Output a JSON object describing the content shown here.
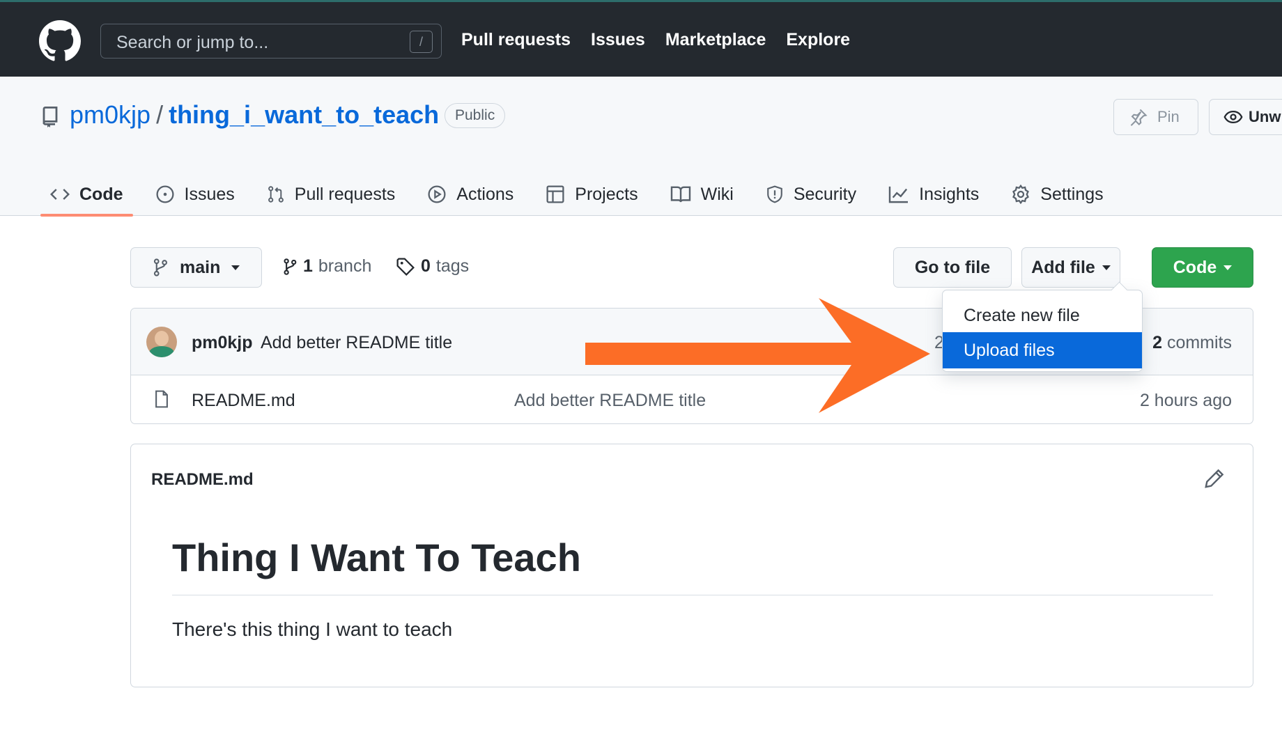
{
  "header": {
    "search_placeholder": "Search or jump to...",
    "search_shortcut": "/",
    "nav": [
      "Pull requests",
      "Issues",
      "Marketplace",
      "Explore"
    ]
  },
  "repo": {
    "owner": "pm0kjp",
    "separator": "/",
    "name": "thing_i_want_to_teach",
    "visibility": "Public",
    "pin_label": "Pin",
    "watch_label": "Unw"
  },
  "tabs": [
    {
      "label": "Code",
      "icon": "code-icon"
    },
    {
      "label": "Issues",
      "icon": "issue-icon"
    },
    {
      "label": "Pull requests",
      "icon": "pull-request-icon"
    },
    {
      "label": "Actions",
      "icon": "play-icon"
    },
    {
      "label": "Projects",
      "icon": "table-icon"
    },
    {
      "label": "Wiki",
      "icon": "book-icon"
    },
    {
      "label": "Security",
      "icon": "shield-icon"
    },
    {
      "label": "Insights",
      "icon": "graph-icon"
    },
    {
      "label": "Settings",
      "icon": "gear-icon"
    }
  ],
  "branchbar": {
    "branch": "main",
    "branch_count": "1",
    "branch_word": "branch",
    "tag_count": "0",
    "tag_word": "tags",
    "go_to_file": "Go to file",
    "add_file": "Add file",
    "code": "Code"
  },
  "add_file_menu": {
    "items": [
      "Create new file",
      "Upload files"
    ],
    "highlighted": "Upload files"
  },
  "latest_commit": {
    "author": "pm0kjp",
    "message": "Add better README title",
    "partial_text": "2",
    "commit_count": "2",
    "commit_word": "commits"
  },
  "files": [
    {
      "name": "README.md",
      "message": "Add better README title",
      "age": "2 hours ago"
    }
  ],
  "readme": {
    "filename": "README.md",
    "heading": "Thing I Want To Teach",
    "body": "There's this thing I want to teach"
  },
  "annotation": {
    "arrow_color": "#fc6d26"
  }
}
